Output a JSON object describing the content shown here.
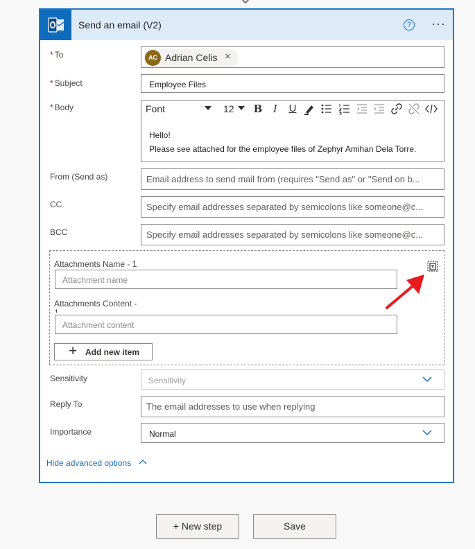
{
  "card": {
    "title": "Send an email (V2)",
    "icons": {
      "app": "outlook-icon",
      "help": "question-circle-icon",
      "more": "ellipsis-icon"
    },
    "help_glyph": "?",
    "more_glyph": "···"
  },
  "required_marker": "*",
  "fields": {
    "to": {
      "label": "To",
      "recipient": {
        "initials": "AC",
        "name": "Adrian Celis",
        "remove_glyph": "×"
      }
    },
    "subject": {
      "label": "Subject",
      "value": "Employee Files"
    },
    "body": {
      "label": "Body",
      "font": "Font",
      "font_size": "12",
      "lines": [
        "Hello!",
        "Please see attached for the employee files of Zephyr Amihan Dela Torre."
      ],
      "toolbar": [
        "bold-icon",
        "italic-icon",
        "underline-icon",
        "highlight-pen-icon",
        "bulleted-list-icon",
        "numbered-list-icon",
        "decrease-indent-icon",
        "increase-indent-icon",
        "link-icon",
        "unlink-icon",
        "code-view-icon"
      ]
    },
    "from": {
      "label": "From (Send as)",
      "placeholder": "Email address to send mail from (requires \"Send as\" or \"Send on b..."
    },
    "cc": {
      "label": "CC",
      "placeholder": "Specify email addresses separated by semicolons like someone@c..."
    },
    "bcc": {
      "label": "BCC",
      "placeholder": "Specify email addresses separated by semicolons like someone@c..."
    },
    "attachments": {
      "name_label": "Attachments Name - 1",
      "name_placeholder": "Attachment name",
      "content_label_line1": "Attachments Content -",
      "content_label_line2": "1",
      "content_placeholder": "Attachment content",
      "add_label": "Add new item",
      "add_glyph": "+",
      "mode_icon": "switch-to-text-mode-icon"
    },
    "sensitivity": {
      "label": "Sensitivity",
      "placeholder": "Sensitivity"
    },
    "reply_to": {
      "label": "Reply To",
      "placeholder": "The email addresses to use when replying"
    },
    "importance": {
      "label": "Importance",
      "value": "Normal"
    }
  },
  "advanced": {
    "toggle_label": "Hide advanced options"
  },
  "footer": {
    "new_step": "+ New step",
    "save": "Save"
  },
  "colors": {
    "accent": "#1f78c5",
    "header_bg": "#dcebf7",
    "annotation_arrow": "#e81c1c",
    "required": "#a4262c",
    "link": "#1b6ec2"
  }
}
